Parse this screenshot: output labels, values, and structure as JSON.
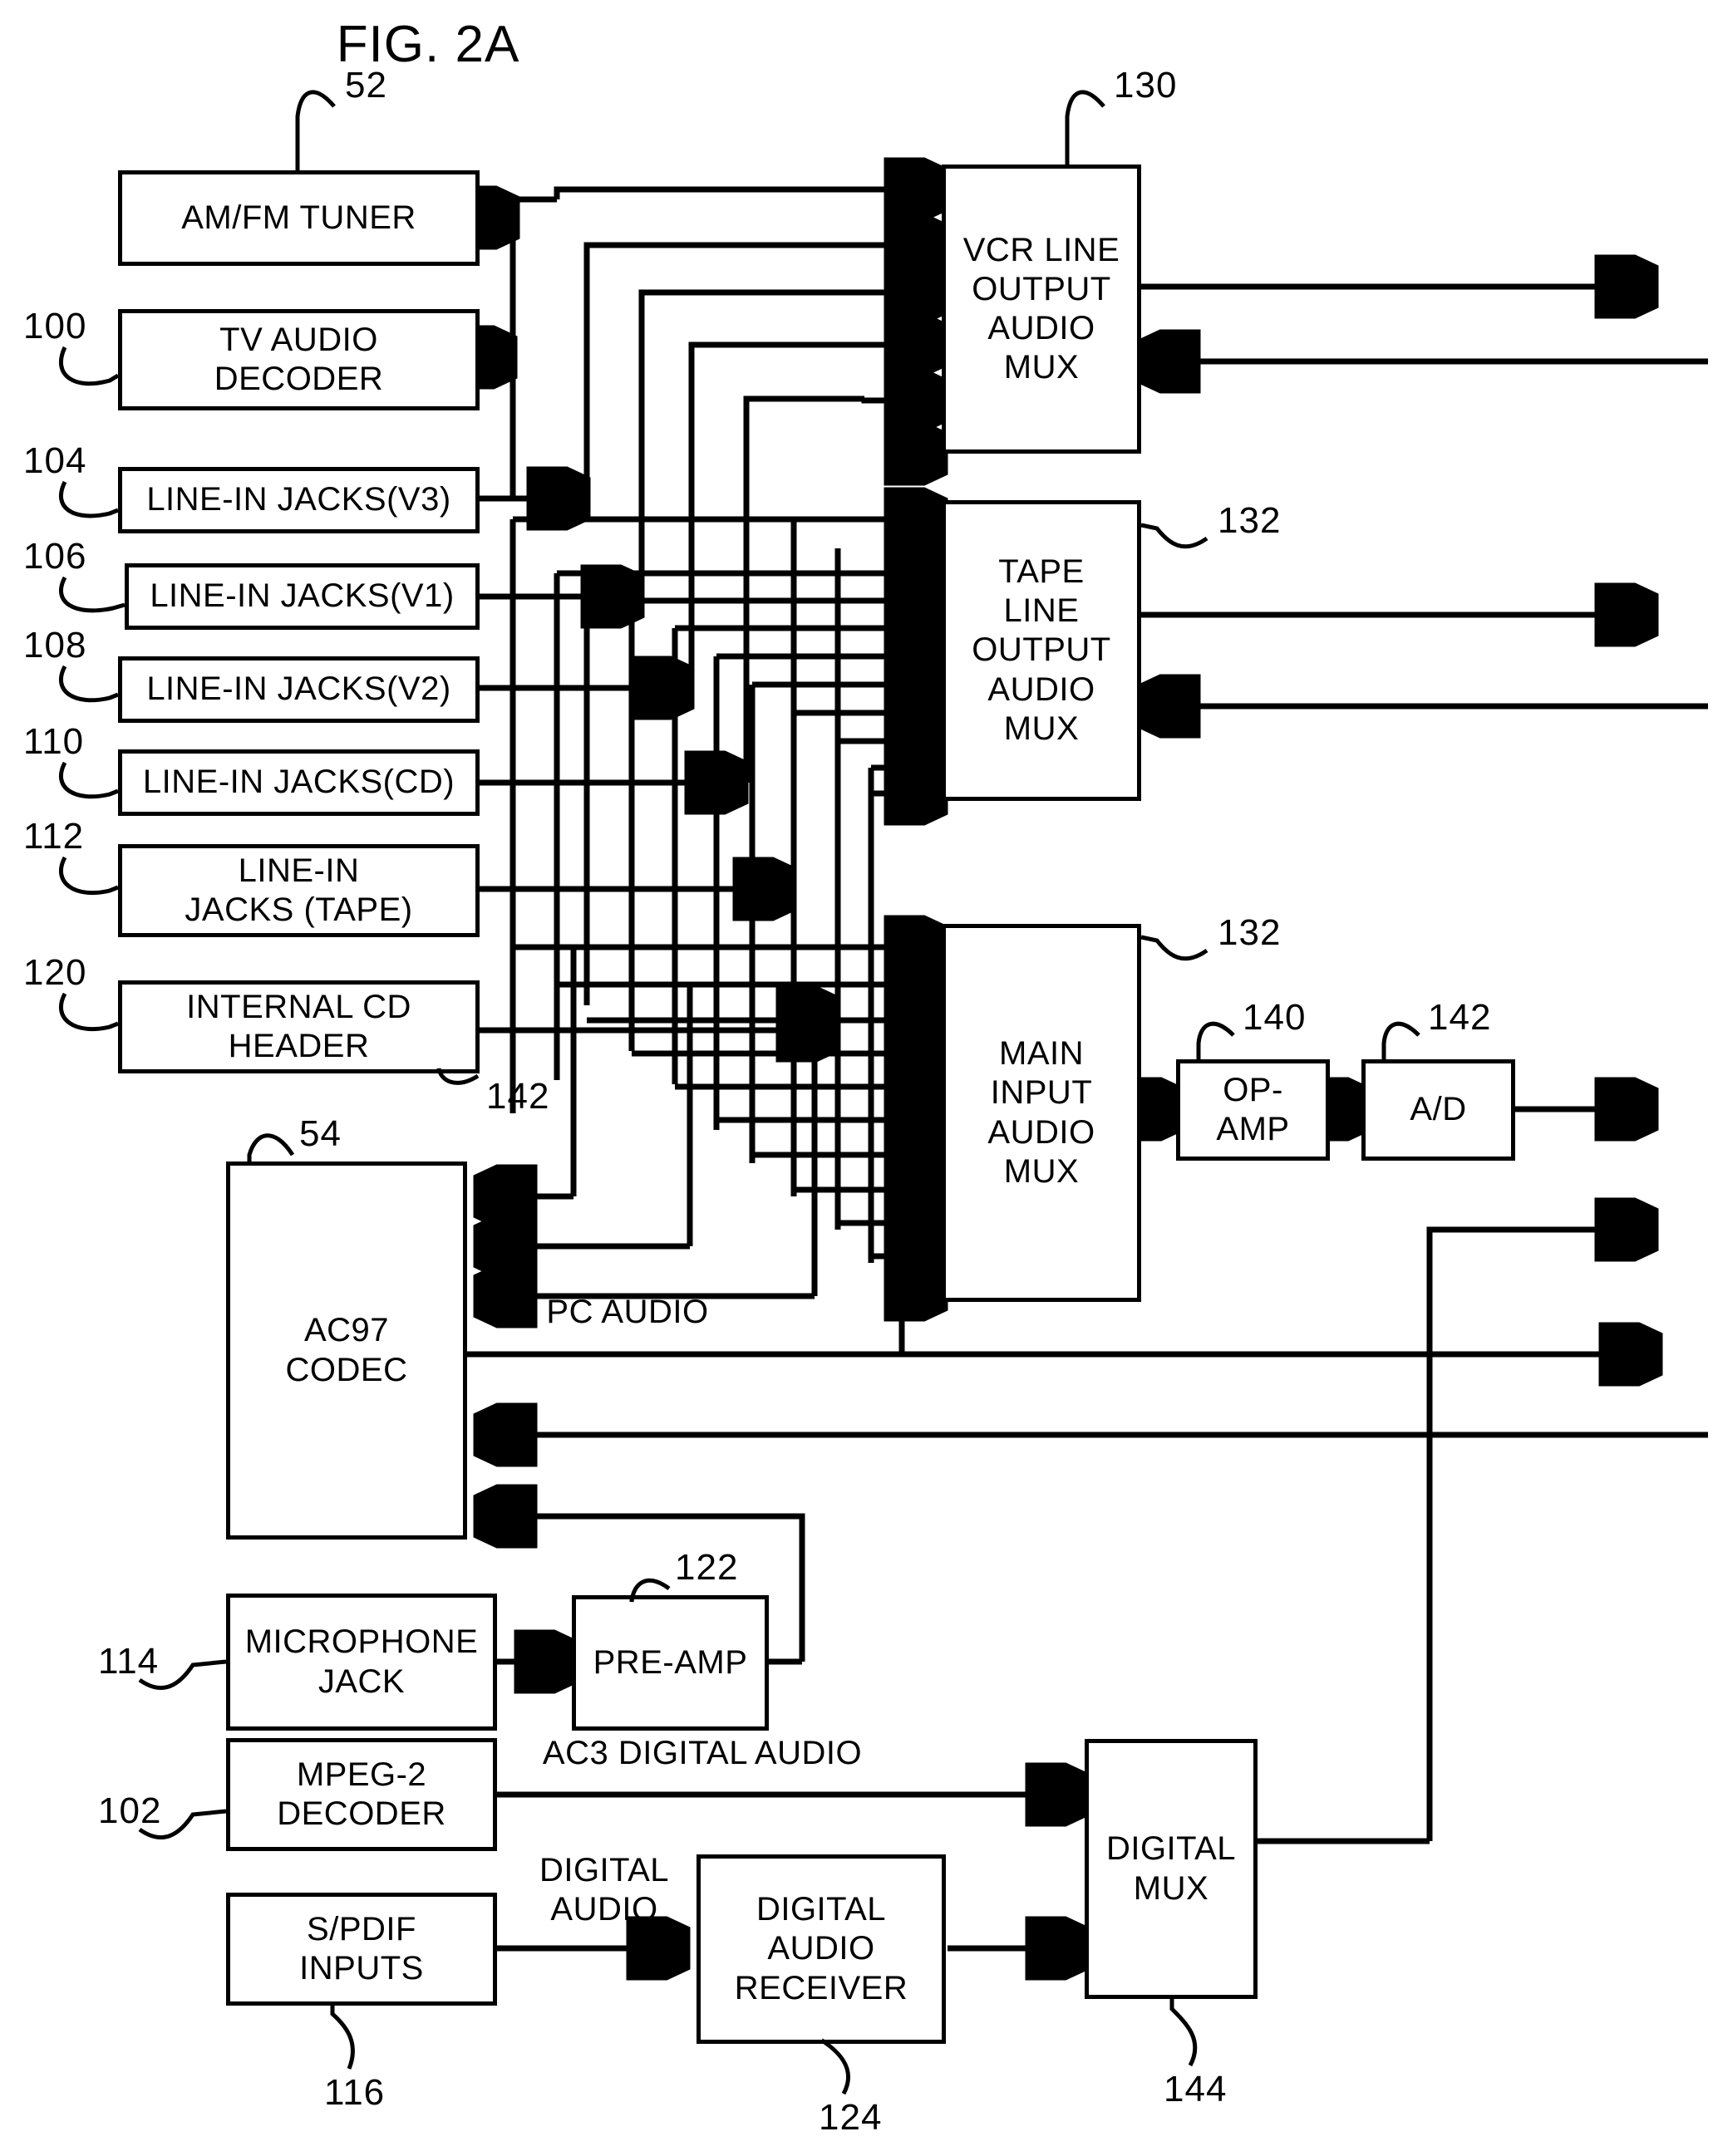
{
  "figure": {
    "title": "FIG. 2A"
  },
  "blocks": [
    {
      "id": "am_fm_tuner",
      "label": "AM/FM TUNER",
      "ref": "52"
    },
    {
      "id": "tv_audio_decoder",
      "label": "TV AUDIO\nDECODER",
      "ref": "100"
    },
    {
      "id": "line_in_v3",
      "label": "LINE-IN JACKS(V3)",
      "ref": "104"
    },
    {
      "id": "line_in_v1",
      "label": "LINE-IN JACKS(V1)",
      "ref": "106"
    },
    {
      "id": "line_in_v2",
      "label": "LINE-IN JACKS(V2)",
      "ref": "108"
    },
    {
      "id": "line_in_cd",
      "label": "LINE-IN JACKS(CD)",
      "ref": "110"
    },
    {
      "id": "line_in_tape",
      "label": "LINE-IN\nJACKS (TAPE)",
      "ref": "112"
    },
    {
      "id": "internal_cd",
      "label": "INTERNAL CD\nHEADER",
      "ref": "120"
    },
    {
      "id": "ac97_codec",
      "label": "AC97\nCODEC",
      "ref": "54"
    },
    {
      "id": "microphone_jack",
      "label": "MICROPHONE\nJACK",
      "ref": "114"
    },
    {
      "id": "pre_amp",
      "label": "PRE-AMP",
      "ref": "122"
    },
    {
      "id": "mpeg2_decoder",
      "label": "MPEG-2\nDECODER",
      "ref": "102"
    },
    {
      "id": "spdif_inputs",
      "label": "S/PDIF\nINPUTS",
      "ref": "116"
    },
    {
      "id": "digital_audio_rx",
      "label": "DIGITAL\nAUDIO\nRECEIVER",
      "ref": "124"
    },
    {
      "id": "digital_mux",
      "label": "DIGITAL\nMUX",
      "ref": "144"
    },
    {
      "id": "vcr_line_mux",
      "label": "VCR LINE\nOUTPUT\nAUDIO\nMUX",
      "ref": "130"
    },
    {
      "id": "tape_line_mux",
      "label": "TAPE\nLINE\nOUTPUT\nAUDIO\nMUX",
      "ref": "132"
    },
    {
      "id": "main_input_mux",
      "label": "MAIN\nINPUT\nAUDIO\nMUX",
      "ref": "132"
    },
    {
      "id": "op_amp",
      "label": "OP-\nAMP",
      "ref": "140"
    },
    {
      "id": "a_d",
      "label": "A/D",
      "ref": "142"
    }
  ],
  "extra_refs": [
    {
      "id": "internal_cd_extra",
      "ref": "142"
    }
  ],
  "wire_labels": [
    {
      "id": "pc_audio",
      "text": "PC AUDIO"
    },
    {
      "id": "ac3_digital_audio",
      "text": "AC3 DIGITAL AUDIO"
    },
    {
      "id": "digital_audio",
      "text": "DIGITAL\nAUDIO"
    }
  ],
  "colors": {
    "ink": "#000000",
    "paper": "#ffffff"
  }
}
